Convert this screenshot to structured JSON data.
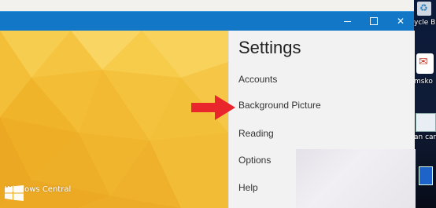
{
  "window": {
    "controls": {
      "minimize_label": "",
      "maximize_label": "",
      "close_label": "✕"
    }
  },
  "settings": {
    "title": "Settings",
    "items": [
      {
        "label": "Accounts"
      },
      {
        "label": "Background Picture"
      },
      {
        "label": "Reading"
      },
      {
        "label": "Options"
      },
      {
        "label": "Help"
      }
    ]
  },
  "watermark": {
    "text": "Windows Central"
  },
  "desktop": {
    "icons": [
      {
        "label": "ycle Bi",
        "icon": "recycle-bin-icon"
      },
      {
        "label": "msko",
        "icon": "mail-app-icon"
      },
      {
        "label": "an car",
        "icon": "document-icon"
      },
      {
        "label": "",
        "icon": "blue-file-icon"
      }
    ]
  },
  "colors": {
    "titlebar": "#1277c7",
    "settings_bg": "#f2f2f2",
    "arrow": "#e8262b",
    "picture_base": "#f6c23c"
  }
}
